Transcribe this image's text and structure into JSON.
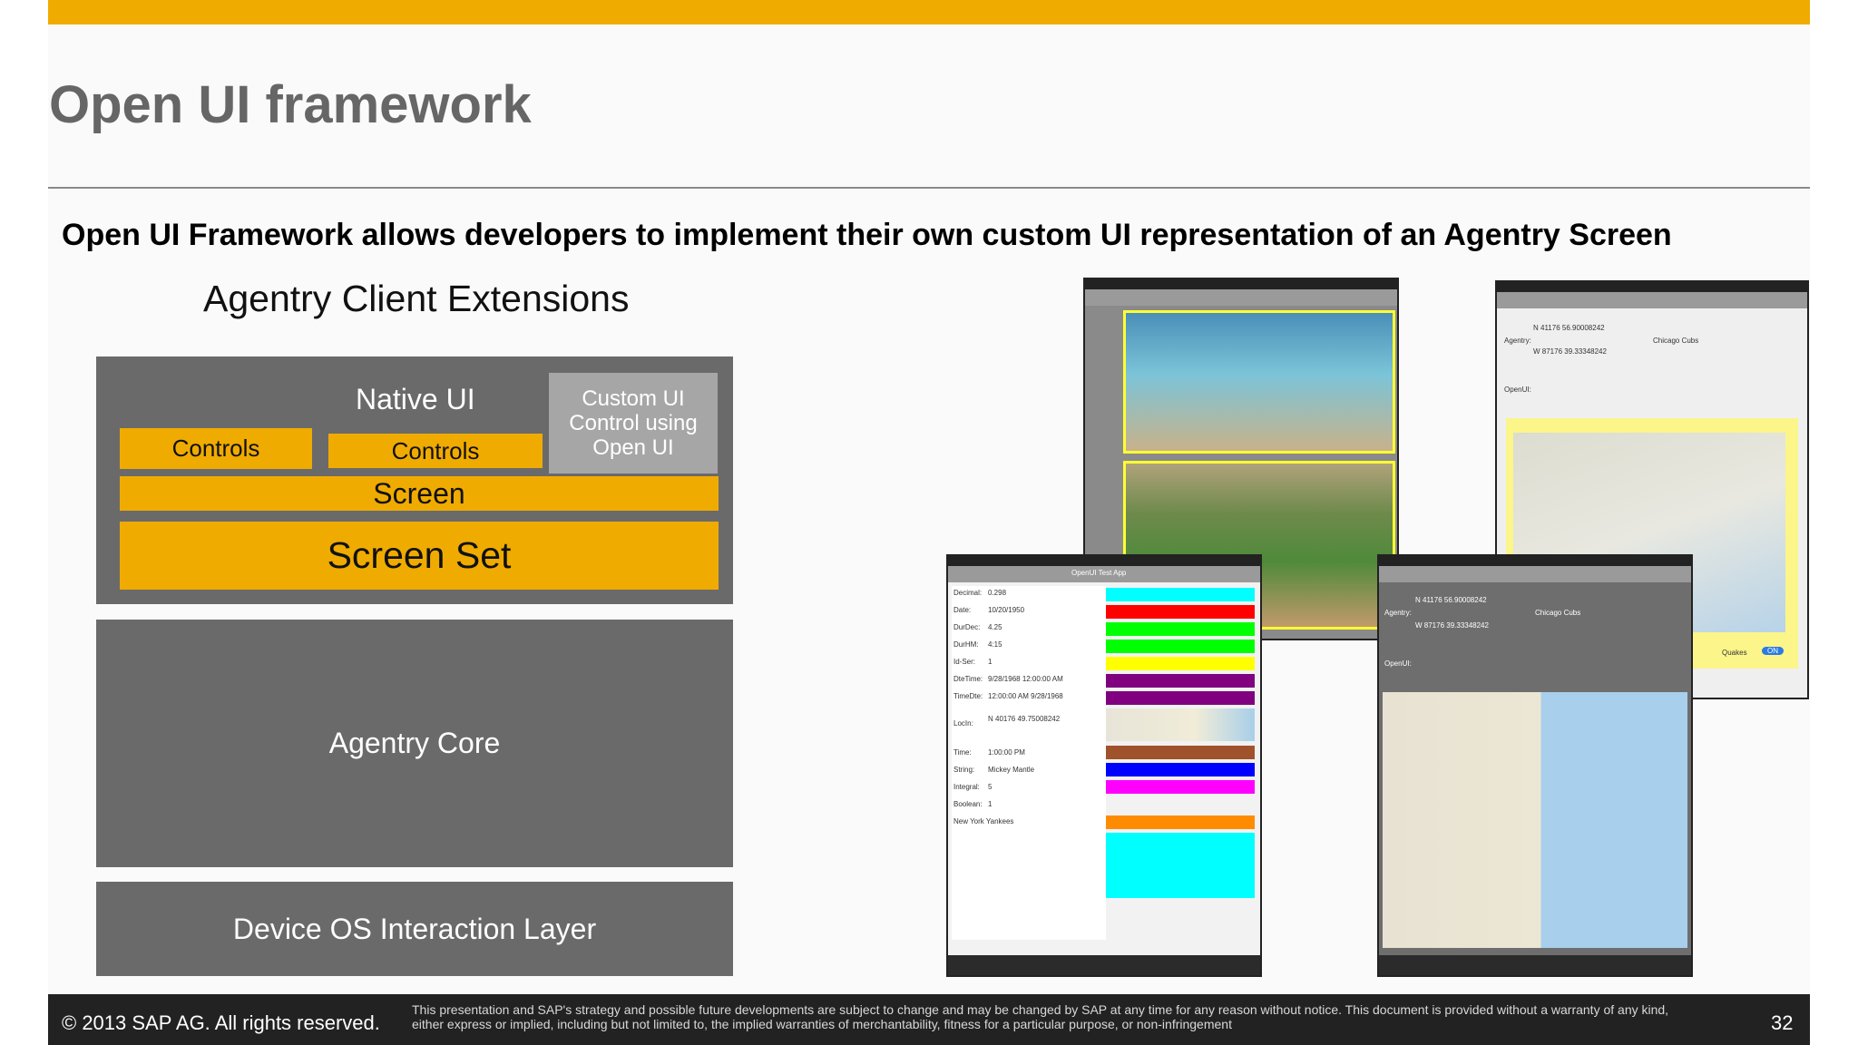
{
  "slide": {
    "title": "Open UI framework",
    "subtitle": "Open UI Framework allows developers to implement their own custom UI representation of an Agentry Screen"
  },
  "diagram": {
    "heading": "Agentry Client Extensions",
    "native_ui": "Native UI",
    "custom_ui": "Custom UI Control using Open UI",
    "controls_1": "Controls",
    "controls_2": "Controls",
    "screen": "Screen",
    "screen_set": "Screen Set",
    "core": "Agentry Core",
    "device_layer": "Device OS Interaction Layer"
  },
  "screenshots": {
    "app_title": "OpenUI Test App",
    "field_labels": [
      "Decimal:",
      "Date:",
      "DurDec:",
      "DurHM:",
      "Id-Ser:",
      "DteTime:",
      "TimeDte:",
      "LocIn:",
      "Time:",
      "String:",
      "Integral:",
      "Boolean:"
    ],
    "field_values": [
      "0.298",
      "10/20/1950",
      "4.25",
      "4:15",
      "1",
      "9/28/1968 12:00:00 AM",
      "12:00:00 AM 9/28/1968",
      "N 40176 49.75008242",
      "1:00:00 PM",
      "Mickey Mantle",
      "5",
      "1"
    ],
    "label_new_york": "New York Yankees",
    "label_chicago": "Chicago Cubs",
    "agentry_label": "Agentry:",
    "openui_label": "OpenUI:",
    "coords_1": "N 41176 56.90008242",
    "coords_2": "W 87176 39.33348242",
    "quakes_label": "Quakes",
    "toggle_on": "ON"
  },
  "colors": {
    "accent": "#f0ab00",
    "box_gray": "#6a6a6a",
    "custom_gray": "#a6a6a6",
    "footer": "#222222"
  },
  "footer": {
    "copyright": "© 2013 SAP AG. All rights reserved.",
    "disclaimer": "This presentation and SAP's strategy and possible future developments are subject to change and may be changed by SAP at any time for any reason without notice. This document is provided without a warranty of any kind, either express or implied, including but not limited to, the implied warranties of merchantability, fitness for a particular purpose, or non-infringement",
    "page_number": "32"
  }
}
